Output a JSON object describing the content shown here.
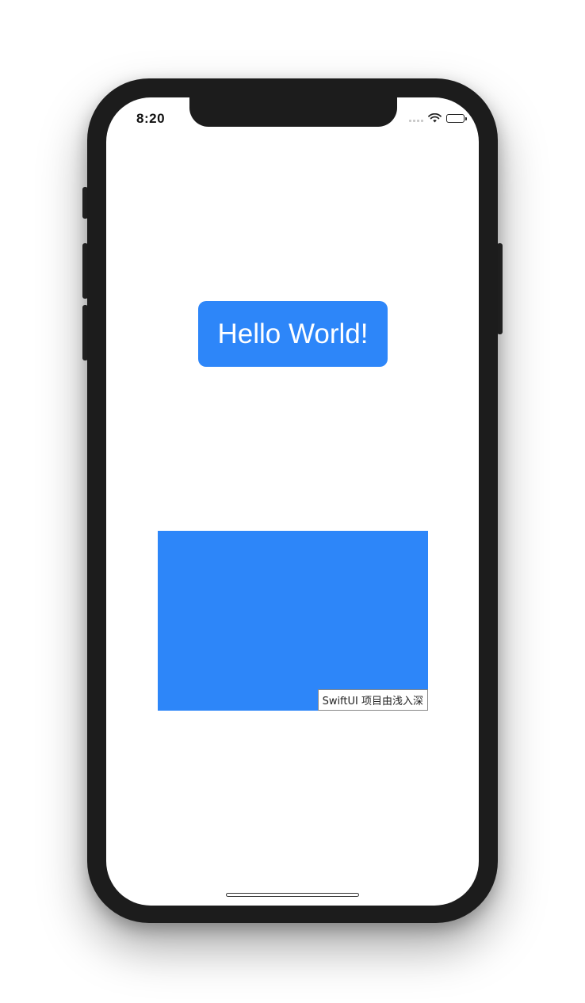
{
  "status_bar": {
    "time": "8:20",
    "icons": [
      "signal-icon",
      "wifi-icon",
      "battery-icon"
    ]
  },
  "main": {
    "button_label": "Hello World!",
    "button_color": "#2d86f9",
    "rect_color": "#2d86f9"
  },
  "watermark": {
    "text": "SwiftUI 项目由浅入深"
  }
}
